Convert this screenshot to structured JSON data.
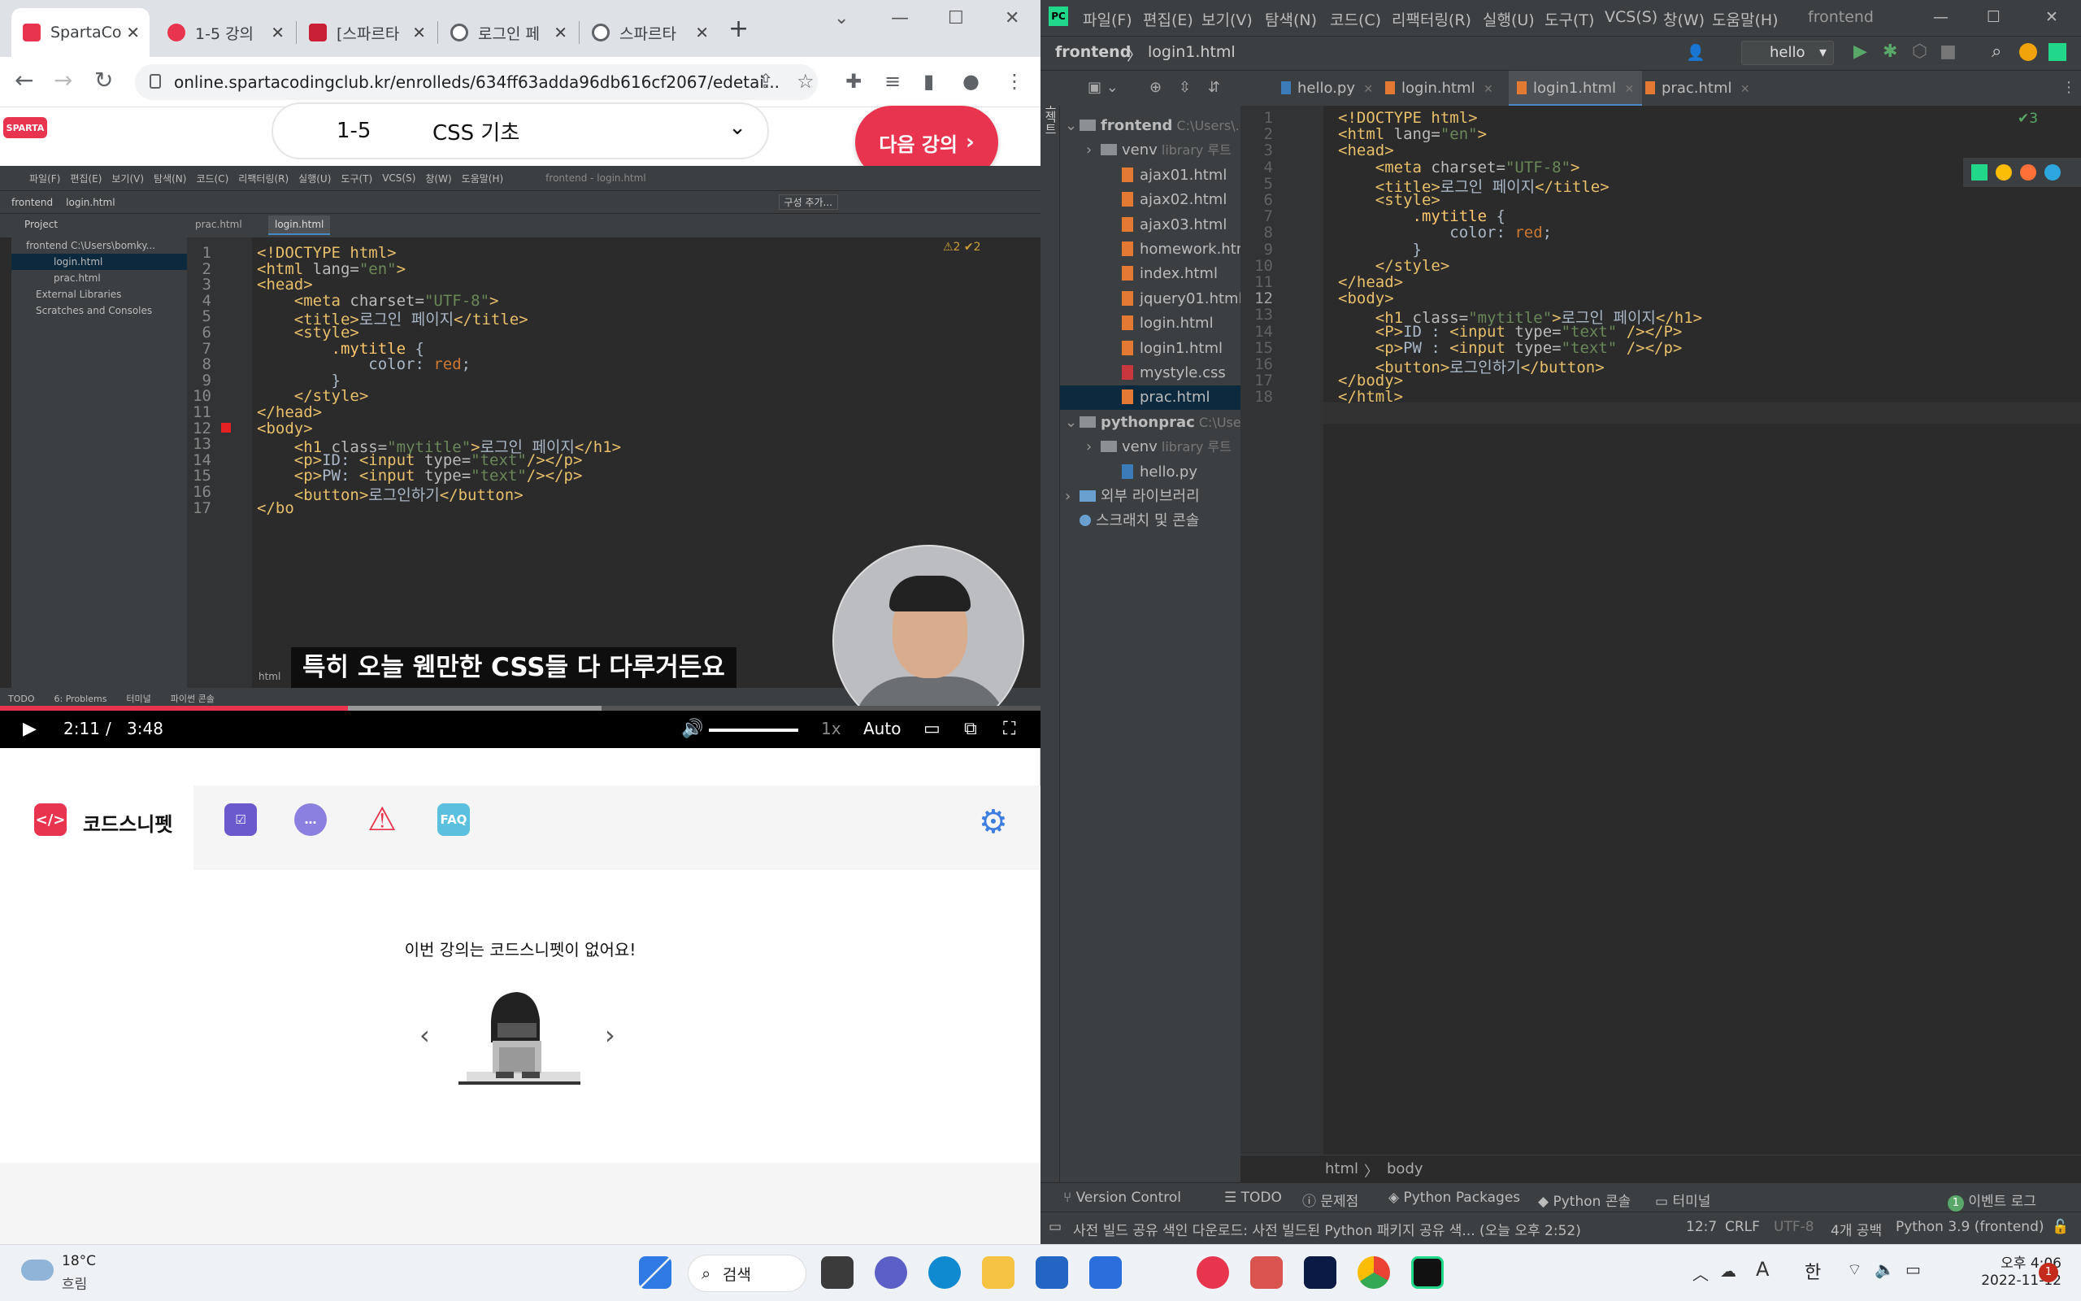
{
  "chrome": {
    "tabs": [
      {
        "label": "SpartaCo",
        "icon": "sparta-favicon",
        "color": "#e8344e"
      },
      {
        "label": "1-5 강의",
        "icon": "heart-favicon",
        "color": "#e8344e"
      },
      {
        "label": "[스파르타",
        "icon": "book-favicon",
        "color": "#c91f37"
      },
      {
        "label": "로그인 페",
        "icon": "globe-favicon",
        "color": "#5f6368"
      },
      {
        "label": "스파르타",
        "icon": "globe-favicon",
        "color": "#5f6368"
      }
    ],
    "url": "online.spartacodingclub.kr/enrolleds/634ff63adda96db616cf2067/edetai...",
    "logo_text": "SPARTA"
  },
  "lecture": {
    "number": "1-5",
    "title": "CSS 기초",
    "next_button": "다음 강의"
  },
  "video": {
    "caption": "특히 오늘 웬만한 CSS들 다 다루거든요",
    "current_time": "2:11",
    "separator": "/",
    "duration": "3:48",
    "speed": "1x",
    "quality": "Auto",
    "progress": 0.578
  },
  "inner_ide": {
    "menu": [
      "파일(F)",
      "편집(E)",
      "보기(V)",
      "탐색(N)",
      "코드(C)",
      "리팩터링(R)",
      "실행(U)",
      "도구(T)",
      "VCS(S)",
      "창(W)",
      "도움말(H)",
      "frontend - login.html"
    ],
    "crumb": [
      "frontend",
      "login.html"
    ],
    "config_label": "구성 추가...",
    "project_label": "Project",
    "tabs": [
      "prac.html",
      "login.html"
    ],
    "tree": [
      "frontend  C:\\Users\\bomky...",
      "login.html",
      "prac.html",
      "External Libraries",
      "Scratches and Consoles"
    ],
    "inspection": "⚠2 ✔2",
    "footer_label": "html",
    "status": [
      "TODO",
      "6: Problems",
      "터미널",
      "파이썬 콘솔"
    ],
    "lines": [
      {
        "n": "1",
        "html": "<span class=\"tg\">&lt;!DOCTYPE html&gt;</span>"
      },
      {
        "n": "2",
        "html": "<span class=\"tg\">&lt;html</span> <span class=\"at\">lang=</span><span class=\"st\">\"en\"</span><span class=\"tg\">&gt;</span>"
      },
      {
        "n": "3",
        "html": "<span class=\"tg\">&lt;head&gt;</span>"
      },
      {
        "n": "4",
        "html": "    <span class=\"tg\">&lt;meta</span> <span class=\"at\">charset=</span><span class=\"st\">\"UTF-8\"</span><span class=\"tg\">&gt;</span>"
      },
      {
        "n": "5",
        "html": "    <span class=\"tg\">&lt;title&gt;</span>로그인 페이지<span class=\"tg\">&lt;/title&gt;</span>"
      },
      {
        "n": "6",
        "html": "    <span class=\"tg\">&lt;style&gt;</span>"
      },
      {
        "n": "7",
        "html": "        <span class=\"cl\">.mytitle</span> {"
      },
      {
        "n": "8",
        "html": "            color: <span class=\"kw\">red</span>;"
      },
      {
        "n": "9",
        "html": "        }"
      },
      {
        "n": "10",
        "html": "    <span class=\"tg\">&lt;/style&gt;</span>"
      },
      {
        "n": "11",
        "html": "<span class=\"tg\">&lt;/head&gt;</span>"
      },
      {
        "n": "12",
        "html": "<span class=\"tg\">&lt;body&gt;</span>"
      },
      {
        "n": "13",
        "html": "    <span class=\"tg\">&lt;h1</span> <span class=\"at\">class=</span><span class=\"st\">\"mytitle\"</span><span class=\"tg\">&gt;</span>로그인 페이지<span class=\"tg\">&lt;/h1&gt;</span>"
      },
      {
        "n": "14",
        "html": "    <span class=\"tg\">&lt;p&gt;</span>ID: <span class=\"tg\">&lt;input</span> <span class=\"at\">type=</span><span class=\"st\">\"text\"</span><span class=\"tg\">/&gt;&lt;/p&gt;</span>"
      },
      {
        "n": "15",
        "html": "    <span class=\"tg\">&lt;p&gt;</span>PW: <span class=\"tg\">&lt;input</span> <span class=\"at\">type=</span><span class=\"st\">\"text\"</span><span class=\"tg\">/&gt;&lt;/p&gt;</span>"
      },
      {
        "n": "16",
        "html": "    <span class=\"tg\">&lt;button&gt;</span>로그인하기<span class=\"tg\">&lt;/button&gt;</span>"
      },
      {
        "n": "17",
        "html": "<span class=\"tg\">&lt;/bo</span>"
      }
    ]
  },
  "snippet": {
    "label": "코드스니펫",
    "logo_text": "</>",
    "faq": "FAQ",
    "empty_message": "이번 강의는 코드스니펫이 없어요!",
    "prev": "‹",
    "next": "›"
  },
  "pycharm": {
    "menu": [
      "파일(F)",
      "편집(E)",
      "보기(V)",
      "탐색(N)",
      "코드(C)",
      "리팩터링(R)",
      "실행(U)",
      "도구(T)",
      "VCS(S)",
      "창(W)",
      "도움말(H)",
      "frontend"
    ],
    "crumb_project": "frontend",
    "crumb_file": "login1.html",
    "run_config": "hello",
    "side_label": "프로젝트",
    "inspection": "✔3",
    "tabs": [
      "hello.py",
      "login.html",
      "login1.html",
      "prac.html"
    ],
    "active_tab": 2,
    "tree": [
      {
        "label": "frontend",
        "hint": "C:\\Users\\...",
        "indent": 0,
        "kind": "folder",
        "open": true
      },
      {
        "label": "venv",
        "hint": "library 루트",
        "indent": 1,
        "kind": "folder",
        "open": false
      },
      {
        "label": "ajax01.html",
        "indent": 2,
        "kind": "file"
      },
      {
        "label": "ajax02.html",
        "indent": 2,
        "kind": "file"
      },
      {
        "label": "ajax03.html",
        "indent": 2,
        "kind": "file"
      },
      {
        "label": "homework.html",
        "indent": 2,
        "kind": "file"
      },
      {
        "label": "index.html",
        "indent": 2,
        "kind": "file"
      },
      {
        "label": "jquery01.html",
        "indent": 2,
        "kind": "file"
      },
      {
        "label": "login.html",
        "indent": 2,
        "kind": "file"
      },
      {
        "label": "login1.html",
        "indent": 2,
        "kind": "file"
      },
      {
        "label": "mystyle.css",
        "indent": 2,
        "kind": "css"
      },
      {
        "label": "prac.html",
        "indent": 2,
        "kind": "file",
        "selected": true
      },
      {
        "label": "pythonprac",
        "hint": "C:\\Use",
        "indent": 0,
        "kind": "folder",
        "open": true
      },
      {
        "label": "venv",
        "hint": "library 루트",
        "indent": 1,
        "kind": "folder",
        "open": false
      },
      {
        "label": "hello.py",
        "indent": 2,
        "kind": "py"
      },
      {
        "label": "외부 라이브러리",
        "indent": 0,
        "kind": "lib",
        "open": false
      },
      {
        "label": "스크래치 및 콘솔",
        "indent": 0,
        "kind": "scratch"
      }
    ],
    "lines": [
      {
        "n": "1",
        "html": "<span class=\"tg\">&lt;!DOCTYPE html&gt;</span>"
      },
      {
        "n": "2",
        "html": "<span class=\"tg\">&lt;html</span> <span class=\"at\">lang=</span><span class=\"st\">\"en\"</span><span class=\"tg\">&gt;</span>"
      },
      {
        "n": "3",
        "html": "<span class=\"tg\">&lt;head&gt;</span>"
      },
      {
        "n": "4",
        "html": "    <span class=\"tg\">&lt;meta</span> <span class=\"at\">charset=</span><span class=\"st\">\"UTF-8\"</span><span class=\"tg\">&gt;</span>"
      },
      {
        "n": "5",
        "html": "    <span class=\"tg\">&lt;title&gt;</span>로그인 페이지<span class=\"tg\">&lt;/title&gt;</span>"
      },
      {
        "n": "6",
        "html": "    <span class=\"tg\">&lt;style&gt;</span>"
      },
      {
        "n": "7",
        "html": "        <span class=\"cl\">.mytitle</span> {"
      },
      {
        "n": "8",
        "html": "            color: <span class=\"kw\">red</span>;"
      },
      {
        "n": "9",
        "html": "        }"
      },
      {
        "n": "10",
        "html": "    <span class=\"tg\">&lt;/style&gt;</span>"
      },
      {
        "n": "11",
        "html": "<span class=\"tg\">&lt;/head&gt;</span>"
      },
      {
        "n": "12",
        "html": "<span class=\"tg\">&lt;body&gt;</span>"
      },
      {
        "n": "13",
        "html": "    <span class=\"tg\">&lt;h1</span> <span class=\"at\">class=</span><span class=\"st\">\"mytitle\"</span><span class=\"tg\">&gt;</span>로그인 페이지<span class=\"tg\">&lt;/h1&gt;</span>"
      },
      {
        "n": "14",
        "html": "    <span class=\"tg\">&lt;P&gt;</span>ID : <span class=\"tg\">&lt;input</span> <span class=\"at\">type=</span><span class=\"st\">\"text\"</span> <span class=\"tg\">/&gt;&lt;/P&gt;</span>"
      },
      {
        "n": "15",
        "html": "    <span class=\"tg\">&lt;p&gt;</span>PW : <span class=\"tg\">&lt;input</span> <span class=\"at\">type=</span><span class=\"st\">\"text\"</span> <span class=\"tg\">/&gt;&lt;/p&gt;</span>"
      },
      {
        "n": "16",
        "html": "    <span class=\"tg\">&lt;button&gt;</span>로그인하기<span class=\"tg\">&lt;/button&gt;</span>"
      },
      {
        "n": "17",
        "html": "<span class=\"tg\">&lt;/body&gt;</span>"
      },
      {
        "n": "18",
        "html": "<span class=\"tg\">&lt;/html&gt;</span>"
      }
    ],
    "breadcrumb": [
      "html",
      "body"
    ],
    "toolwindows": [
      "Version Control",
      "TODO",
      "문제점",
      "Python Packages",
      "Python 콘솔",
      "터미널"
    ],
    "event_log": "이벤트 로그",
    "event_count": "1",
    "status_message": "사전 빌드 공유 색인 다운로드: 사전 빌드된 Python 패키지 공유 색... (오늘 오후 2:52)",
    "status_right": [
      "12:7",
      "CRLF",
      "UTF-8",
      "4개 공백",
      "Python 3.9 (frontend)"
    ]
  },
  "taskbar": {
    "weather_temp": "18°C",
    "weather_desc": "흐림",
    "search": "검색",
    "time": "오후 4:06",
    "date": "2022-11-12",
    "ime": "한",
    "notif": "1"
  }
}
